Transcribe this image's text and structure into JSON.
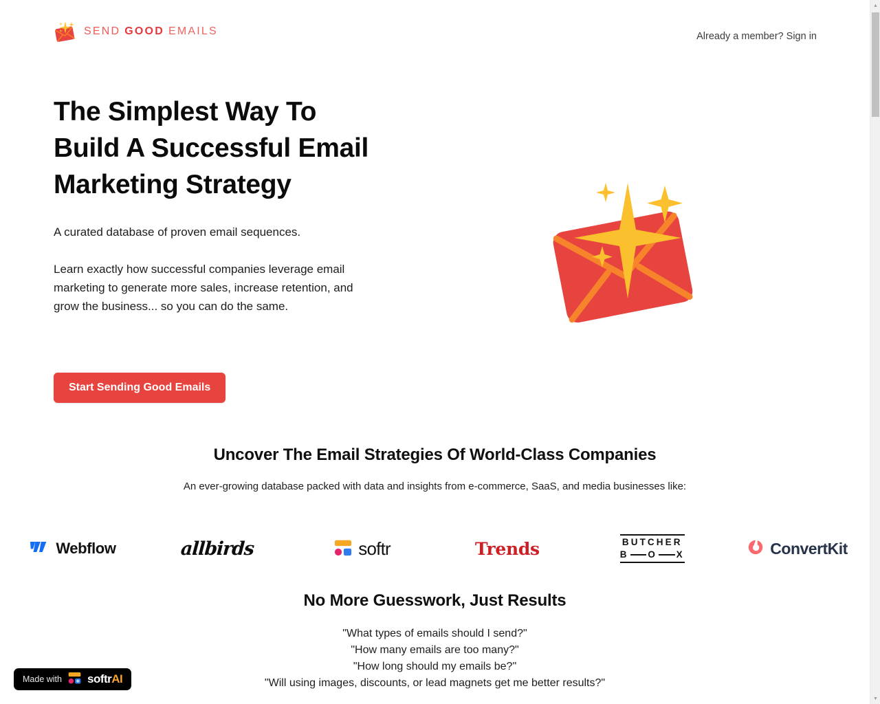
{
  "header": {
    "brand": {
      "icon": "sparkle-envelope-logo-icon",
      "word1": "SEND",
      "word2": "GOOD",
      "word3": "EMAILS"
    },
    "signin_label": "Already a member? Sign in"
  },
  "hero": {
    "title_lines": [
      "The Simplest Way To",
      "Build A Successful Email",
      "Marketing Strategy"
    ],
    "subtitle": "A curated database of proven email sequences.",
    "body": "Learn exactly how successful companies leverage email marketing to generate more sales, increase retention, and grow the business... so you can do the same.",
    "cta_label": "Start Sending Good Emails",
    "illustration": "sparkling-envelope-illustration"
  },
  "brands_section": {
    "title": "Uncover The Email Strategies Of World-Class Companies",
    "subtitle": "An ever-growing database packed with data and insights from e-commerce, SaaS, and media businesses like:",
    "logos": [
      {
        "name": "Webflow",
        "icon": "webflow-logo-icon"
      },
      {
        "name": "allbirds",
        "icon": "allbirds-logo-icon"
      },
      {
        "name": "softr",
        "icon": "softr-logo-icon"
      },
      {
        "name": "Trends",
        "icon": "trends-logo-icon"
      },
      {
        "name": "BUTCHER BOX",
        "icon": "butcherbox-logo-icon",
        "line1": "BUTCHER",
        "box_b": "B",
        "box_o": "O",
        "box_x": "X"
      },
      {
        "name": "ConvertKit",
        "icon": "convertkit-logo-icon"
      }
    ]
  },
  "guesswork_section": {
    "title": "No More Guesswork, Just Results",
    "questions": [
      "\"What types of emails should I send?\"",
      "\"How many emails are too many?\"",
      "\"How long should my emails be?\"",
      "\"Will using images, discounts, or lead magnets get me better results?\""
    ]
  },
  "badge": {
    "made_with": "Made with",
    "brand": "softr",
    "suffix": "AI",
    "icon": "softr-mark-icon"
  },
  "scrollbar": {
    "up_arrow": "▲",
    "down_arrow": "▼"
  },
  "colors": {
    "brand_red": "#e8443f",
    "brand_red_light": "#ef5a5a",
    "sparkle_yellow": "#fbc02d",
    "webflow_blue": "#146ef5",
    "trends_red": "#cc2027",
    "convertkit_coral": "#fb6970",
    "convertkit_navy": "#27324b",
    "softr_orange": "#f5a623",
    "softr_pink": "#e6246e",
    "softr_blue": "#2f7ced",
    "badge_accent": "#f6a42a"
  }
}
